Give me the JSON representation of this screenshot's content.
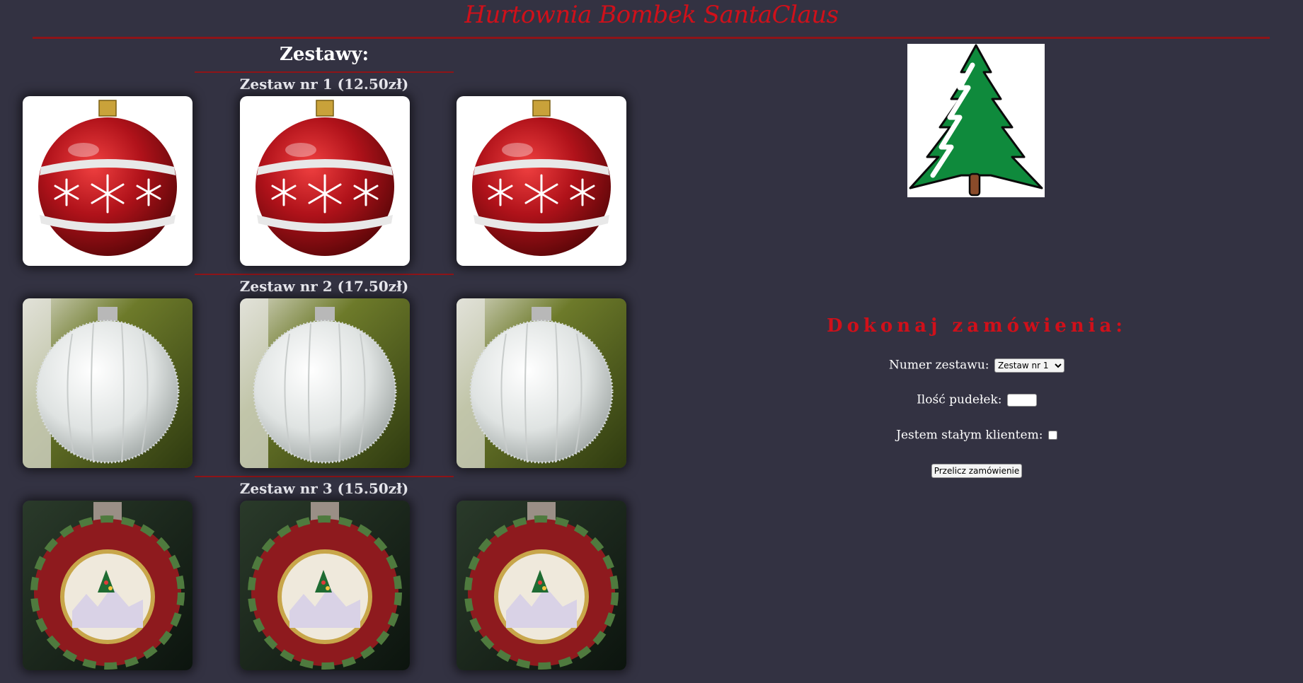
{
  "header": {
    "title": "Hurtownia Bombek SantaClaus"
  },
  "sets": {
    "heading": "Zestawy:",
    "items": [
      {
        "title": "Zestaw nr 1 (12.50zł)",
        "image": "red-snowflake-bauble"
      },
      {
        "title": "Zestaw nr 2 (17.50zł)",
        "image": "white-glitter-bauble"
      },
      {
        "title": "Zestaw nr 3 (15.50zł)",
        "image": "painted-winter-scene-bauble"
      }
    ]
  },
  "decor": {
    "tree_icon": "christmas-tree-icon"
  },
  "order": {
    "heading": "Dokonaj zamówienia:",
    "set_label": "Numer zestawu:",
    "set_selected": "Zestaw nr 1",
    "qty_label": "Ilość pudełek:",
    "qty_value": "",
    "regular_label": "Jestem stałym klientem:",
    "submit_label": "Przelicz zamówienie"
  },
  "colors": {
    "background": "#333242",
    "accent": "#d0101a",
    "rule": "#8e1418"
  }
}
